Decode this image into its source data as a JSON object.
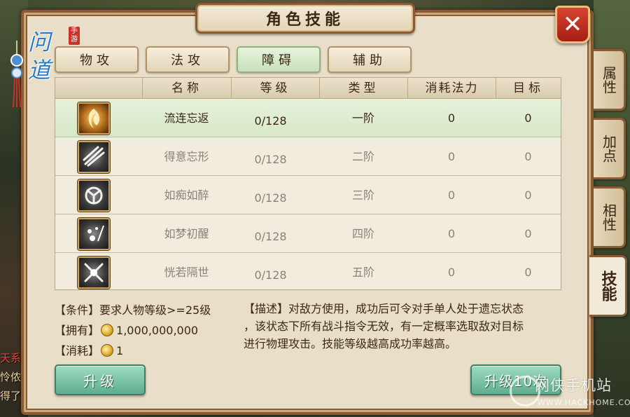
{
  "game": {
    "logo_text": "问道",
    "logo_badge": "手游"
  },
  "background": {
    "left_texts": [
      "天系",
      "怜侬",
      "得了"
    ]
  },
  "window": {
    "title": "角色技能",
    "close_label": "✕"
  },
  "category_tabs": [
    {
      "label": "物攻",
      "active": false
    },
    {
      "label": "法攻",
      "active": false
    },
    {
      "label": "障碍",
      "active": true
    },
    {
      "label": "辅助",
      "active": false
    }
  ],
  "side_tabs": [
    {
      "label": "属性",
      "active": false
    },
    {
      "label": "加点",
      "active": false
    },
    {
      "label": "相性",
      "active": false
    },
    {
      "label": "技能",
      "active": true
    }
  ],
  "table": {
    "headers": [
      "名称",
      "等级",
      "类型",
      "消耗法力",
      "目标"
    ],
    "rows": [
      {
        "icon": "gold-swirl-skill-icon",
        "name": "流连忘返",
        "level": "0/128",
        "type": "一阶",
        "mana": "0",
        "target": "0",
        "selected": true
      },
      {
        "icon": "dark-slash-skill-icon",
        "name": "得意忘形",
        "level": "0/128",
        "type": "二阶",
        "mana": "0",
        "target": "0",
        "selected": false
      },
      {
        "icon": "dark-emblem-skill-icon",
        "name": "如痴如醉",
        "level": "0/128",
        "type": "三阶",
        "mana": "0",
        "target": "0",
        "selected": false
      },
      {
        "icon": "dark-sparkle-skill-icon",
        "name": "如梦初醒",
        "level": "0/128",
        "type": "四阶",
        "mana": "0",
        "target": "0",
        "selected": false
      },
      {
        "icon": "dark-blade-skill-icon",
        "name": "恍若隔世",
        "level": "0/128",
        "type": "五阶",
        "mana": "0",
        "target": "0",
        "selected": false
      }
    ]
  },
  "info": {
    "condition_label": "【条件】",
    "condition_value": "要求人物等级>=25级",
    "owned_label": "【拥有】",
    "owned_value": "1,000,000,000",
    "cost_label": "【消耗】",
    "cost_value": "1",
    "desc_label": "【描述】",
    "desc_text": "对敌方使用，成功后可令对手单人处于遗忘状态，该状态下所有战斗指令无效，有一定概率选取敌对目标进行物理攻击。技能等级越高成功率越高。",
    "desc_lines": [
      "对敌方使用，成功后可令对手单人处于遗忘状态",
      "，该状态下所有战斗指令无效，有一定概率选取敌对目标",
      "进行物理攻击。技能等级越高成功率越高。"
    ]
  },
  "buttons": {
    "upgrade": "升级",
    "upgrade_10": "升级10次"
  },
  "watermark": {
    "text": "网侠手机站",
    "sub": "WWW.HACKHOME.COM"
  },
  "colors": {
    "panel_bg": "#e9dfc9",
    "border": "#8a5a35",
    "selected_row": "#e6f1da",
    "button_green": "#6fbf9c",
    "close_red": "#c0321f"
  }
}
